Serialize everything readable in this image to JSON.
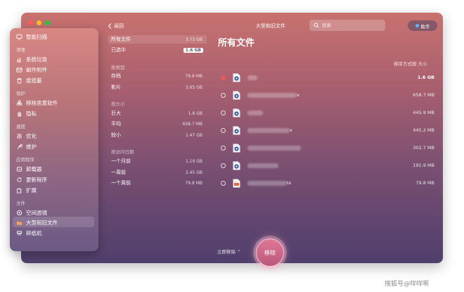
{
  "titlebar": {
    "back_label": "返回",
    "title": "大型和旧文件",
    "search_placeholder": "搜索",
    "helper_label": "助手"
  },
  "sidebar": {
    "top_item": "智能扫描",
    "sections": [
      {
        "title": "清理",
        "items": [
          "系统垃圾",
          "邮件附件",
          "废纸篓"
        ]
      },
      {
        "title": "保护",
        "items": [
          "移除恶意软件",
          "隐私"
        ]
      },
      {
        "title": "速度",
        "items": [
          "优化",
          "维护"
        ]
      },
      {
        "title": "应用程序",
        "items": [
          "卸载器",
          "更新程序",
          "扩展"
        ]
      },
      {
        "title": "文件",
        "items": [
          "空间透镜",
          "大型和旧文件",
          "碎纸机"
        ]
      }
    ]
  },
  "categories": {
    "all_label": "所有文件",
    "all_size": "3.73 GB",
    "selected_label": "已选中",
    "selected_size": "1.6 GB",
    "by_kind_title": "按类型",
    "by_kind": [
      {
        "label": "存档",
        "size": "79.8 MB"
      },
      {
        "label": "影片",
        "size": "3.65 GB"
      }
    ],
    "by_size_title": "按大小",
    "by_size": [
      {
        "label": "巨大",
        "size": "1.6 GB"
      },
      {
        "label": "平均",
        "size": "658.7 MB"
      },
      {
        "label": "较小",
        "size": "1.47 GB"
      }
    ],
    "by_access_title": "按访问日期",
    "by_access": [
      {
        "label": "一个月前",
        "size": "1.19 GB"
      },
      {
        "label": "一周前",
        "size": "2.45 GB"
      },
      {
        "label": "一个周前",
        "size": "79.8 MB"
      }
    ]
  },
  "main": {
    "title": "所有文件",
    "sort_label": "排序方式按 大小",
    "files": [
      {
        "name_suffix": "",
        "size": "1.6 GB",
        "checked": true
      },
      {
        "name_suffix": "v",
        "size": "658.7 MB",
        "checked": false
      },
      {
        "name_suffix": "",
        "size": "445.9 MB",
        "checked": false
      },
      {
        "name_suffix": "v",
        "size": "445.2 MB",
        "checked": false
      },
      {
        "name_suffix": "",
        "size": "302.7 MB",
        "checked": false
      },
      {
        "name_suffix": "",
        "size": "191.9 MB",
        "checked": false
      },
      {
        "name_suffix": "tx",
        "size": "79.8 MB",
        "checked": false
      }
    ],
    "immediate_remove": "立即移除",
    "remove_button": "移除"
  },
  "watermark": "搜狐号@咩咩啊",
  "colors": {
    "close": "#ff5f57",
    "minimize": "#febc2e",
    "zoom": "#28c840",
    "checked_radio": "#e85a5a",
    "helper_dot": "#5ab4ff"
  }
}
